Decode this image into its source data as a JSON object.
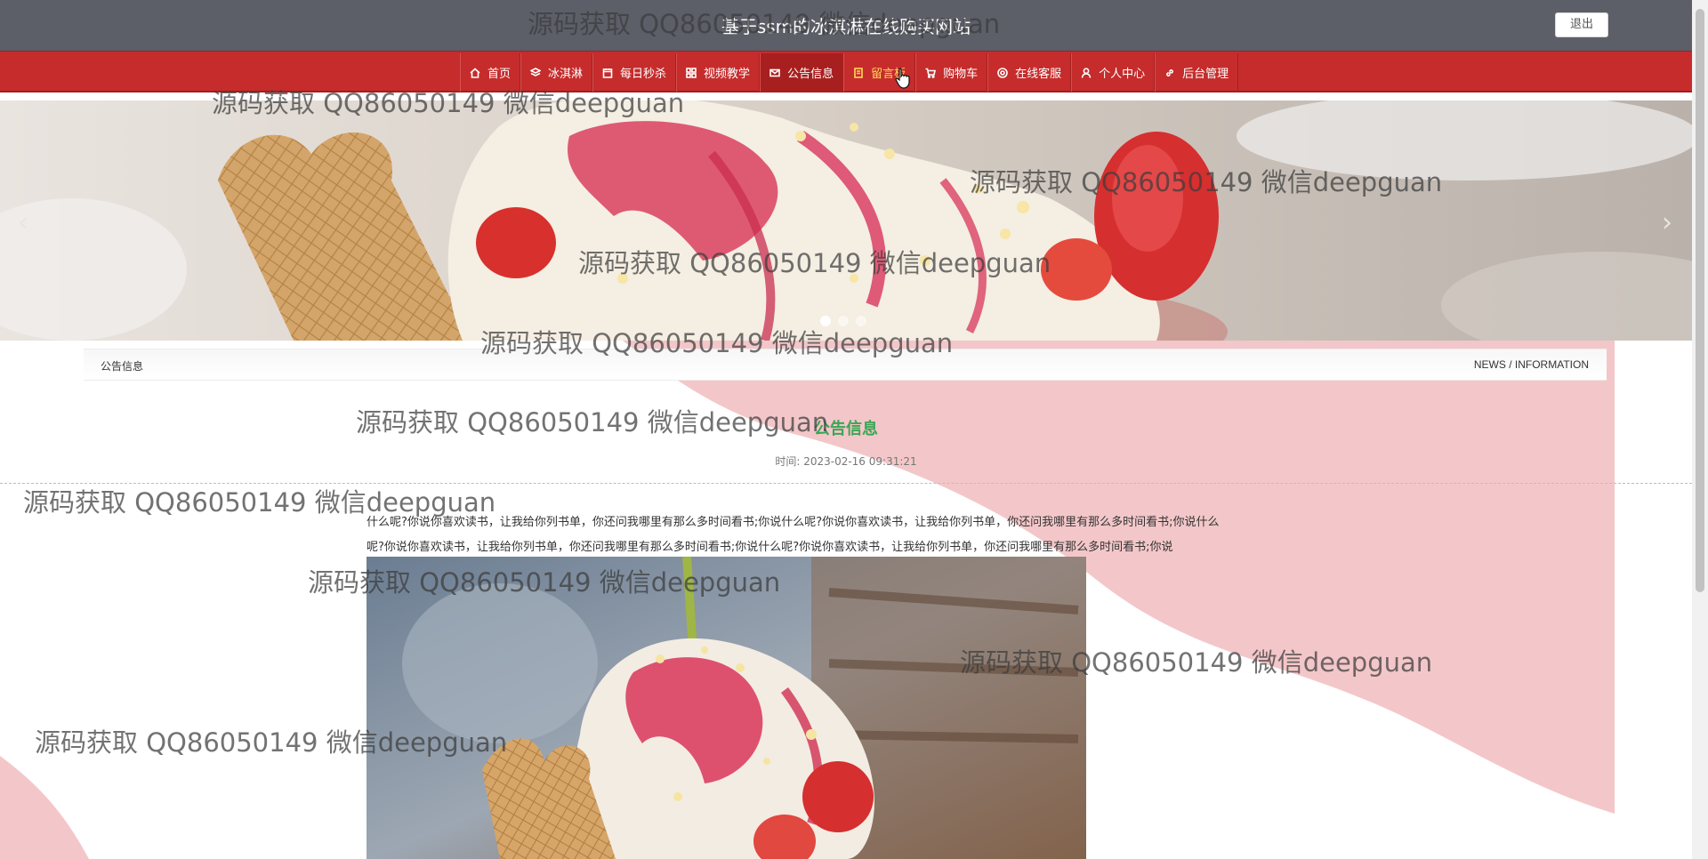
{
  "header": {
    "site_title": "基于ssm的冰淇淋在线购买网站",
    "logout_label": "退出"
  },
  "nav": {
    "items": [
      {
        "label": "首页",
        "icon": "home-icon"
      },
      {
        "label": "冰淇淋",
        "icon": "layers-icon"
      },
      {
        "label": "每日秒杀",
        "icon": "calendar-icon"
      },
      {
        "label": "视频教学",
        "icon": "grid-icon"
      },
      {
        "label": "公告信息",
        "icon": "mail-icon"
      },
      {
        "label": "留言板",
        "icon": "note-icon"
      },
      {
        "label": "购物车",
        "icon": "cart-icon"
      },
      {
        "label": "在线客服",
        "icon": "support-icon"
      },
      {
        "label": "个人中心",
        "icon": "user-icon"
      },
      {
        "label": "后台管理",
        "icon": "link-icon"
      }
    ],
    "active_index": 4,
    "hover_index": 5
  },
  "banner": {
    "prev_label": "‹",
    "next_label": "›",
    "active_slide": 1
  },
  "breadcrumb": {
    "left": "公告信息",
    "right": "NEWS / INFORMATION"
  },
  "article": {
    "title": "公告信息",
    "time_label": "时间:",
    "time_value": "2023-02-16 09:31:21",
    "body_line_1": "什么呢?你说你喜欢读书，让我给你列书单，你还问我哪里有那么多时间看书;你说什么呢?你说你喜欢读书，让我给你列书单，你还问我哪里有那么多时间看书;你说什么",
    "body_line_2": "呢?你说你喜欢读书，让我给你列书单，你还问我哪里有那么多时间看书;你说什么呢?你说你喜欢读书，让我给你列书单，你还问我哪里有那么多时间看书;你说"
  },
  "watermark_text": "源码获取 QQ86050149 微信deepguan",
  "colors": {
    "header_bg": "#5c5e68",
    "nav_bg": "#c62c2c",
    "title_green": "#3aa655",
    "accent_pink": "#f2c6c8"
  }
}
